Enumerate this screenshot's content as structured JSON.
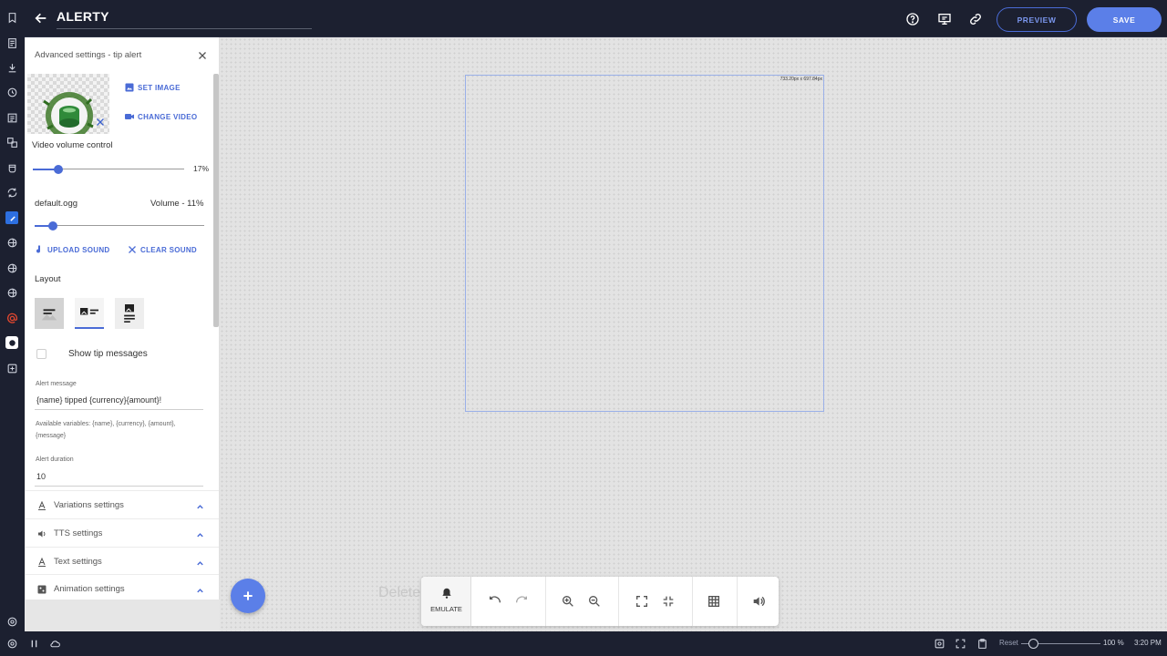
{
  "app": {
    "title": "ALERTY",
    "preview_label": "PREVIEW",
    "save_label": "SAVE"
  },
  "rail_icons": [
    "bookmark-icon",
    "document-icon",
    "download-icon",
    "history-icon",
    "list-icon",
    "layers-icon",
    "cup-icon",
    "refresh-icon",
    "app-icon",
    "globe-icon",
    "globe-icon",
    "globe-icon",
    "at-icon",
    "app-icon",
    "plus-icon",
    "settings-icon"
  ],
  "panel": {
    "title": "Advanced settings - tip alert",
    "set_image": "SET IMAGE",
    "change_video": "CHANGE VIDEO",
    "video_volume_label": "Video volume control",
    "video_volume_value": "17%",
    "video_volume_level": 17,
    "sound_file": "default.ogg",
    "sound_volume_label": "Volume - 11%",
    "sound_volume_level": 11,
    "upload_sound": "UPLOAD SOUND",
    "clear_sound": "CLEAR SOUND",
    "layout_label": "Layout",
    "show_tip_messages": "Show tip messages",
    "alert_message_label": "Alert message",
    "alert_message_value": "{name} tipped {currency}{amount}!",
    "available_vars": "Available variables: {name}, {currency}, {amount}, {message}",
    "alert_duration_label": "Alert duration",
    "alert_duration_value": "10",
    "sections": [
      {
        "label": "Variations settings",
        "icon": "text-icon"
      },
      {
        "label": "TTS settings",
        "icon": "speaker-icon"
      },
      {
        "label": "Text settings",
        "icon": "text-icon"
      },
      {
        "label": "Animation settings",
        "icon": "animation-icon"
      }
    ]
  },
  "canvas": {
    "frame_size": "733.20px x 697.84px",
    "delete_hint": "Delete"
  },
  "toolbar": {
    "emulate_label": "EMULATE"
  },
  "statusbar": {
    "reset_label": "Reset",
    "zoom_value": "100 %",
    "zoom_level": 15,
    "time": "3:20 PM"
  },
  "colors": {
    "accent": "#5b7fe8",
    "dark_bg": "#1c2030"
  }
}
